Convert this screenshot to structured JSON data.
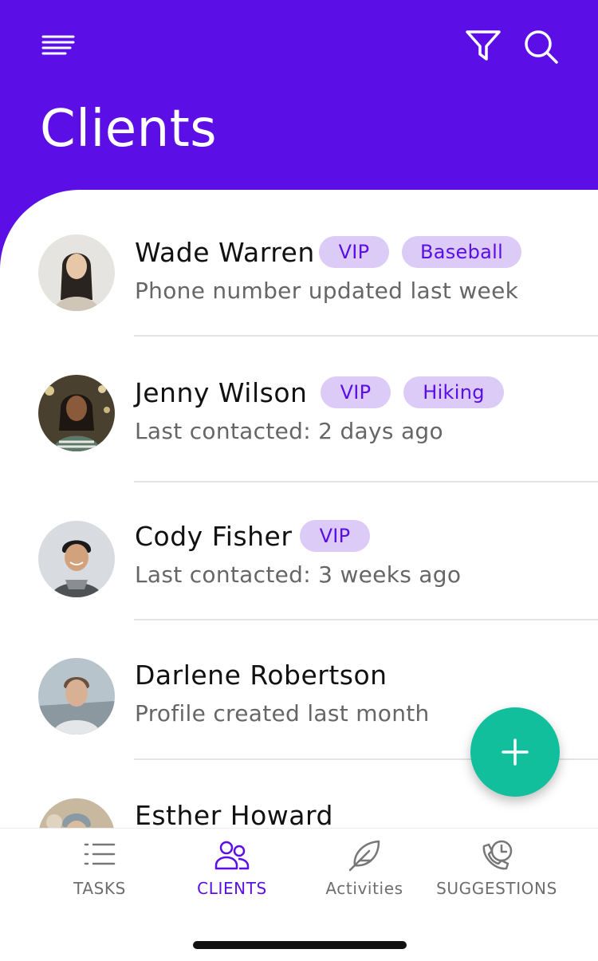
{
  "header": {
    "title": "Clients",
    "menu_icon": "menu-icon",
    "filter_icon": "filter-icon",
    "search_icon": "search-icon",
    "background_color": "#5b0ee6"
  },
  "clients": [
    {
      "name": "Wade Warren",
      "tags": [
        "VIP",
        "Baseball"
      ],
      "subtitle": "Phone number updated last week"
    },
    {
      "name": "Jenny Wilson",
      "tags": [
        "VIP",
        "Hiking"
      ],
      "subtitle": "Last contacted: 2 days ago"
    },
    {
      "name": "Cody Fisher",
      "tags": [
        "VIP"
      ],
      "subtitle": "Last contacted: 3 weeks ago"
    },
    {
      "name": "Darlene Robertson",
      "tags": [],
      "subtitle": "Profile created last month"
    },
    {
      "name": "Esther Howard",
      "tags": [],
      "subtitle": ""
    }
  ],
  "fab": {
    "icon": "plus-icon",
    "color": "#12bf9c"
  },
  "tabs": [
    {
      "label": "TASKS",
      "icon": "list-icon",
      "active": false
    },
    {
      "label": "CLIENTS",
      "icon": "people-icon",
      "active": true
    },
    {
      "label": "Activities",
      "icon": "feather-icon",
      "active": false
    },
    {
      "label": "SUGGESTIONS",
      "icon": "phone-clock-icon",
      "active": false
    }
  ],
  "colors": {
    "accent": "#5b0ee6",
    "tag_bg": "#dccaf7",
    "fab": "#12bf9c"
  }
}
